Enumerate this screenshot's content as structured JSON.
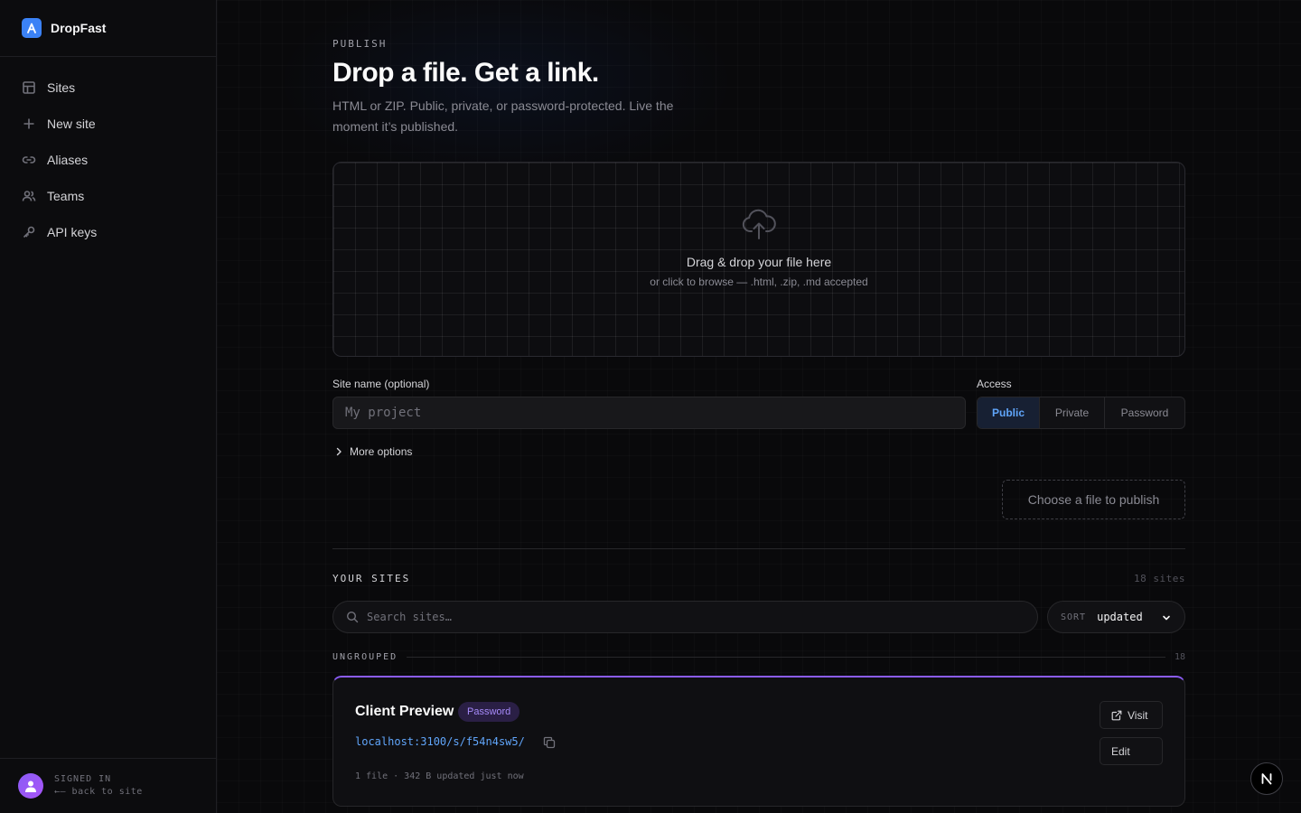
{
  "app": {
    "name": "DropFast",
    "logo_letter": "A",
    "accent": "#3b82f6"
  },
  "sidebar": {
    "items": [
      {
        "label": "Sites",
        "icon": "grid-icon"
      },
      {
        "label": "New site",
        "icon": "plus-icon"
      },
      {
        "label": "Aliases",
        "icon": "link-icon"
      },
      {
        "label": "Teams",
        "icon": "users-icon"
      },
      {
        "label": "API keys",
        "icon": "key-icon"
      }
    ],
    "footer": {
      "status": "SIGNED IN",
      "back_link": "←— back to site"
    }
  },
  "publish": {
    "eyebrow": "PUBLISH",
    "title": "Drop a file. Get a link.",
    "subtitle": "HTML or ZIP. Public, private, or password-protected. Live the moment it’s published.",
    "dropzone": {
      "title": "Drag & drop your file here",
      "subtitle": "or click to browse — .html, .zip, .md accepted"
    },
    "site_name": {
      "label": "Site name (optional)",
      "placeholder": "My project",
      "value": ""
    },
    "access": {
      "label": "Access",
      "options": [
        "Public",
        "Private",
        "Password"
      ],
      "selected": "Public"
    },
    "more_options": "More options",
    "submit_label": "Choose a file to publish"
  },
  "sites": {
    "heading": "YOUR SITES",
    "count": "18 sites",
    "search_placeholder": "Search sites…",
    "sort": {
      "label": "SORT",
      "value": "updated"
    },
    "group": {
      "label": "UNGROUPED",
      "count": "18"
    },
    "cards": [
      {
        "title": "Client Preview",
        "badge": "Password",
        "url": "localhost:3100/s/f54n4sw5/",
        "meta": "1 file · 342 B   updated just now",
        "visit_label": "Visit",
        "edit_label": "Edit"
      }
    ]
  },
  "fab": {
    "label": "N"
  }
}
